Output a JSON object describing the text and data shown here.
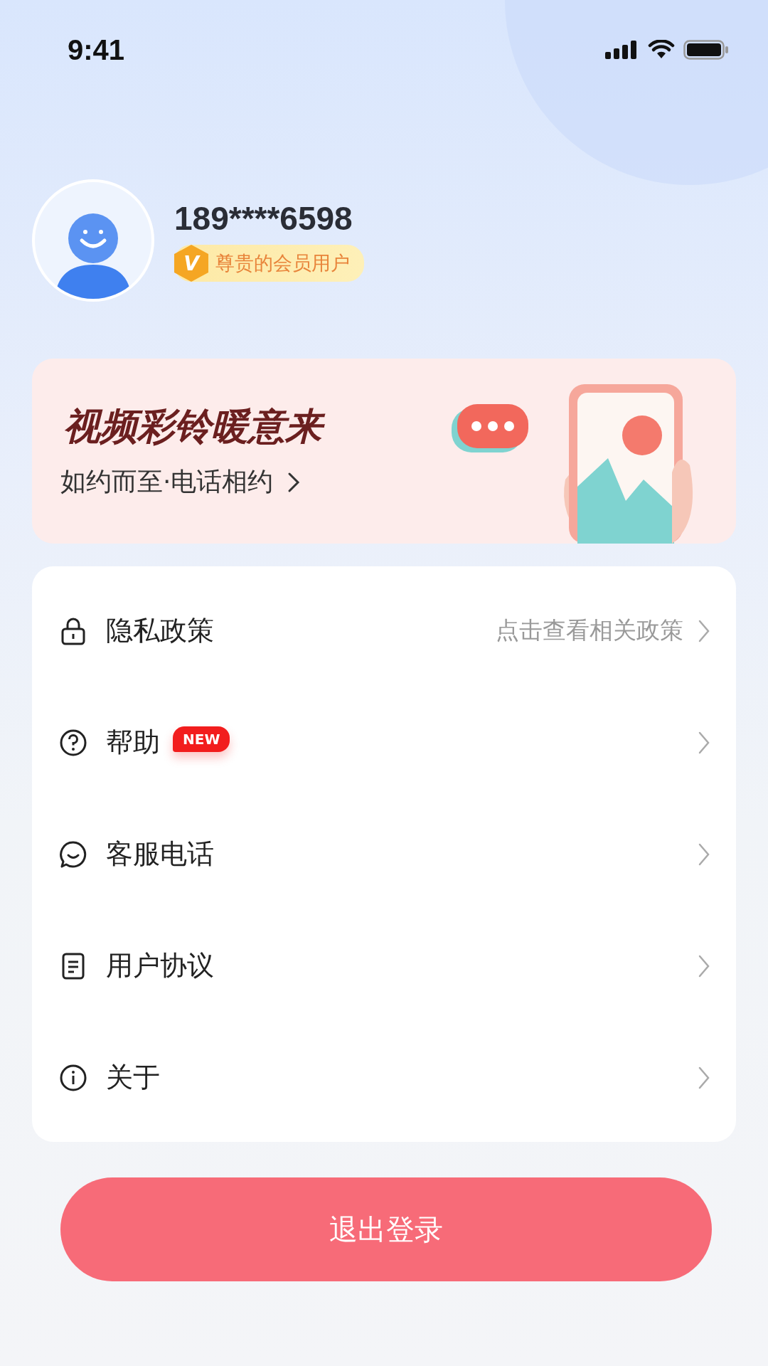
{
  "status_bar": {
    "time": "9:41"
  },
  "profile": {
    "phone": "189****6598",
    "member_badge": {
      "icon_letter": "V",
      "label": "尊贵的会员用户"
    }
  },
  "banner": {
    "title": "视频彩铃暖意来",
    "subtitle": "如约而至·电话相约"
  },
  "menu": [
    {
      "label": "隐私政策",
      "hint": "点击查看相关政策"
    },
    {
      "label": "帮助",
      "badge": "NEW"
    },
    {
      "label": "客服电话"
    },
    {
      "label": "用户协议"
    },
    {
      "label": "关于"
    }
  ],
  "logout_button": "退出登录"
}
